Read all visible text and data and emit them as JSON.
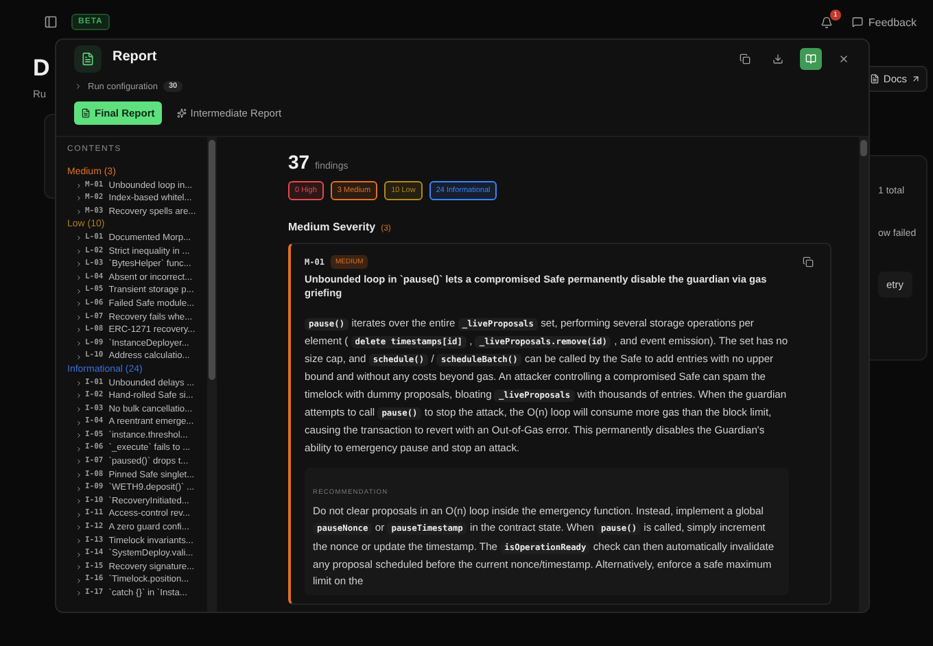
{
  "top_bar": {
    "badge": "BETA",
    "notification_count": "1",
    "feedback": "Feedback"
  },
  "background": {
    "heading": "D",
    "subtitle": "Ru",
    "docs": "Docs",
    "side_texts": [
      "1 total",
      "ow failed"
    ],
    "side_button": "etry"
  },
  "modal": {
    "title": "Report",
    "reader_view_on": true,
    "run_configuration": {
      "label": "Run configuration",
      "count": "30",
      "expanded": false
    },
    "tabs": [
      {
        "label": "Final Report",
        "selected": true
      },
      {
        "label": "Intermediate Report",
        "selected": false
      }
    ],
    "contents": {
      "title": "CONTENTS",
      "groups": [
        {
          "title": "Medium (3)",
          "color": "#e0701f",
          "items": [
            {
              "id": "M-01",
              "title": "Unbounded loop in..."
            },
            {
              "id": "M-02",
              "title": "Index-based whitel..."
            },
            {
              "id": "M-03",
              "title": "Recovery spells are..."
            }
          ]
        },
        {
          "title": "Low (10)",
          "color": "#b07d1c",
          "items": [
            {
              "id": "L-01",
              "title": "Documented Morp..."
            },
            {
              "id": "L-02",
              "title": "Strict inequality in ..."
            },
            {
              "id": "L-03",
              "title": "`BytesHelper` func..."
            },
            {
              "id": "L-04",
              "title": "Absent or incorrect..."
            },
            {
              "id": "L-05",
              "title": "Transient storage p..."
            },
            {
              "id": "L-06",
              "title": "Failed Safe module..."
            },
            {
              "id": "L-07",
              "title": "Recovery fails whe..."
            },
            {
              "id": "L-08",
              "title": "ERC-1271 recovery..."
            },
            {
              "id": "L-09",
              "title": "`InstanceDeployer..."
            },
            {
              "id": "L-10",
              "title": "Address calculatio..."
            }
          ]
        },
        {
          "title": "Informational (24)",
          "color": "#3b6fd8",
          "items": [
            {
              "id": "I-01",
              "title": "Unbounded delays ..."
            },
            {
              "id": "I-02",
              "title": "Hand-rolled Safe si..."
            },
            {
              "id": "I-03",
              "title": "No bulk cancellatio..."
            },
            {
              "id": "I-04",
              "title": "A reentrant emerge..."
            },
            {
              "id": "I-05",
              "title": "`instance.threshol..."
            },
            {
              "id": "I-06",
              "title": "`_execute` fails to ..."
            },
            {
              "id": "I-07",
              "title": "`paused()` drops t..."
            },
            {
              "id": "I-08",
              "title": "Pinned Safe singlet..."
            },
            {
              "id": "I-09",
              "title": "`WETH9.deposit()` ..."
            },
            {
              "id": "I-10",
              "title": "`RecoveryInitiated..."
            },
            {
              "id": "I-11",
              "title": "Access-control rev..."
            },
            {
              "id": "I-12",
              "title": "A zero guard confi..."
            },
            {
              "id": "I-13",
              "title": "Timelock invariants..."
            },
            {
              "id": "I-14",
              "title": "`SystemDeploy.vali..."
            },
            {
              "id": "I-15",
              "title": "Recovery signature..."
            },
            {
              "id": "I-16",
              "title": "`Timelock.position..."
            },
            {
              "id": "I-17",
              "title": "`catch {}` in `Insta..."
            }
          ]
        }
      ]
    },
    "summary": {
      "count": "37",
      "label": "findings",
      "badges": [
        {
          "label": "0 High",
          "color": "#e5484d"
        },
        {
          "label": "3 Medium",
          "color": "#e0701f"
        },
        {
          "label": "10 Low",
          "color": "#b08a1a"
        },
        {
          "label": "24 Informational",
          "color": "#3b82f6"
        }
      ]
    },
    "section": {
      "title": "Medium Severity",
      "count": "(3)",
      "color": "#e0701f"
    },
    "finding": {
      "id": "M-01",
      "severity": "MEDIUM",
      "color": "#e0701f",
      "title": "Unbounded loop in `pause()` lets a compromised Safe permanently disable the guardian via gas griefing",
      "description": [
        {
          "kind": "code",
          "text": "pause()"
        },
        {
          "kind": "text",
          "text": " iterates over the entire "
        },
        {
          "kind": "code",
          "text": "_liveProposals"
        },
        {
          "kind": "text",
          "text": " set, performing several storage operations per element ( "
        },
        {
          "kind": "code",
          "text": "delete timestamps[id]"
        },
        {
          "kind": "text",
          "text": " , "
        },
        {
          "kind": "code",
          "text": "_liveProposals.remove(id)"
        },
        {
          "kind": "text",
          "text": " , and event emission). The set has no size cap, and "
        },
        {
          "kind": "code",
          "text": "schedule()"
        },
        {
          "kind": "text",
          "text": " / "
        },
        {
          "kind": "code",
          "text": "scheduleBatch()"
        },
        {
          "kind": "text",
          "text": " can be called by the Safe to add entries with no upper bound and without any costs beyond gas. An attacker controlling a compromised Safe can spam the timelock with dummy proposals, bloating "
        },
        {
          "kind": "code",
          "text": "_liveProposals"
        },
        {
          "kind": "text",
          "text": " with thousands of entries. When the guardian attempts to call "
        },
        {
          "kind": "code",
          "text": "pause()"
        },
        {
          "kind": "text",
          "text": " to stop the attack, the O(n) loop will consume more gas than the block limit, causing the transaction to revert with an Out-of-Gas error. This permanently disables the Guardian's ability to emergency pause and stop an attack."
        }
      ],
      "recommendation": {
        "label": "RECOMMENDATION",
        "text": [
          {
            "kind": "text",
            "text": "Do not clear proposals in an O(n) loop inside the emergency function. Instead, implement a global "
          },
          {
            "kind": "code",
            "text": "pauseNonce"
          },
          {
            "kind": "text",
            "text": " or "
          },
          {
            "kind": "code",
            "text": "pauseTimestamp"
          },
          {
            "kind": "text",
            "text": " in the contract state. When "
          },
          {
            "kind": "code",
            "text": "pause()"
          },
          {
            "kind": "text",
            "text": " is called, simply increment the nonce or update the timestamp. The "
          },
          {
            "kind": "code",
            "text": "isOperationReady"
          },
          {
            "kind": "text",
            "text": " check can then automatically invalidate any proposal scheduled before the current nonce/timestamp. Alternatively, enforce a safe maximum limit on the"
          }
        ]
      }
    }
  }
}
